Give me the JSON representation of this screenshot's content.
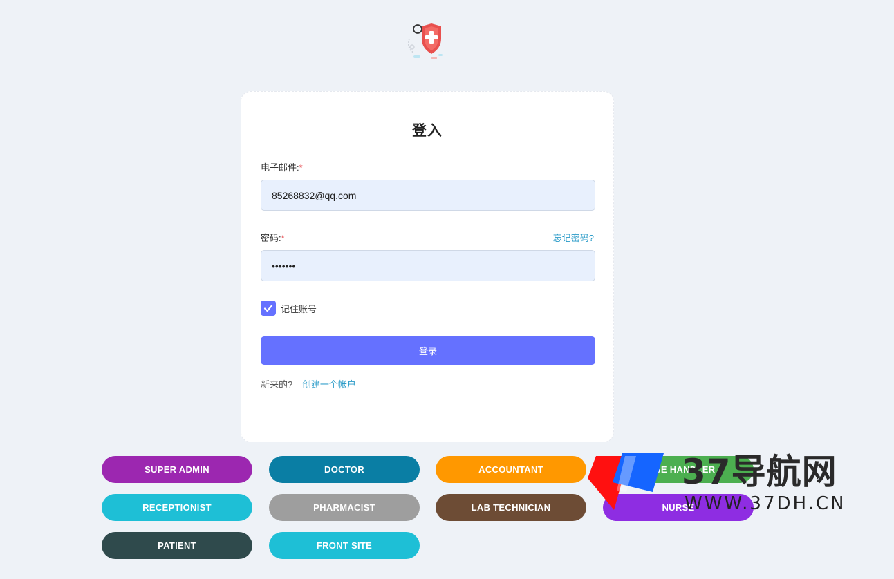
{
  "login": {
    "title": "登入",
    "email_label": "电子邮件:",
    "email_value": "85268832@qq.com",
    "password_label": "密码:",
    "required_mark": "*",
    "forgot_password": "忘记密码?",
    "password_value": "•••••••",
    "remember_label": "记住账号",
    "remember_checked": true,
    "submit_label": "登录",
    "new_prompt": "新来的?",
    "create_account": "创建一个帐户"
  },
  "roles": [
    {
      "label": "SUPER ADMIN",
      "color": "#9c27b0"
    },
    {
      "label": "DOCTOR",
      "color": "#0a7ea4"
    },
    {
      "label": "ACCOUNTANT",
      "color": "#ff9800"
    },
    {
      "label": "CASE HANDLER",
      "color": "#4caf50"
    },
    {
      "label": "RECEPTIONIST",
      "color": "#1ebfd6"
    },
    {
      "label": "PHARMACIST",
      "color": "#9e9e9e"
    },
    {
      "label": "LAB TECHNICIAN",
      "color": "#6d4c35"
    },
    {
      "label": "NURSE",
      "color": "#8e2de2"
    },
    {
      "label": "PATIENT",
      "color": "#2f4a4c"
    },
    {
      "label": "FRONT SITE",
      "color": "#1ebfd6"
    }
  ],
  "watermark": {
    "title": "37导航网",
    "url": "WWW.37DH.CN"
  },
  "colors": {
    "primary": "#6571ff",
    "link": "#2a9bc8",
    "required": "#e5484d",
    "input_bg": "#e8f0fd",
    "page_bg": "#eef2f7"
  }
}
